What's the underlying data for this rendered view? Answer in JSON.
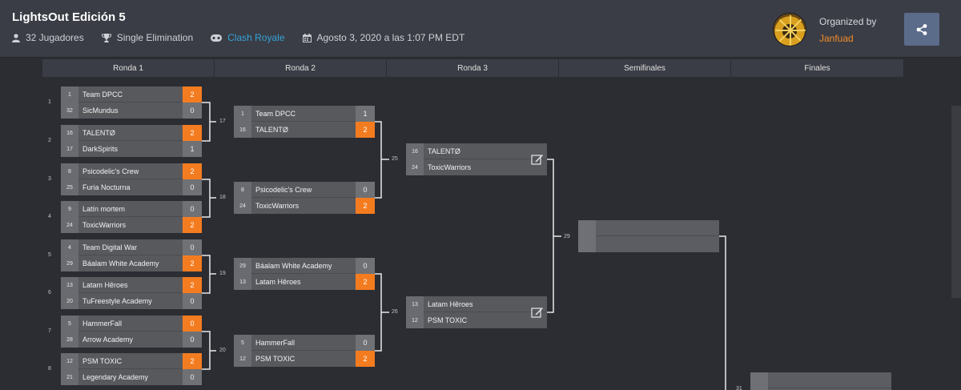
{
  "header": {
    "title": "LightsOut Edición 5",
    "players": "32 Jugadores",
    "format": "Single Elimination",
    "game": "Clash Royale",
    "date": "Agosto 3, 2020 a las 1:07 PM EDT",
    "organized_by_label": "Organized by",
    "organizer": "Janfuad"
  },
  "rounds": [
    "Ronda 1",
    "Ronda 2",
    "Ronda 3",
    "Semifinales",
    "Finales"
  ],
  "round1": [
    {
      "num": "17",
      "p1": {
        "seed": "1",
        "name": "Team DPCC",
        "score": "2",
        "win": true
      },
      "p2": {
        "seed": "32",
        "name": "SicMundus",
        "score": "0",
        "win": false
      }
    },
    {
      "num": "17",
      "p1": {
        "seed": "16",
        "name": "TALENTØ",
        "score": "2",
        "win": true
      },
      "p2": {
        "seed": "17",
        "name": "DarkSpirits",
        "score": "1",
        "win": false
      }
    },
    {
      "num": "18",
      "p1": {
        "seed": "8",
        "name": "Psicodelic's Crew",
        "score": "2",
        "win": true
      },
      "p2": {
        "seed": "25",
        "name": "Furia Nocturna",
        "score": "0",
        "win": false
      }
    },
    {
      "num": "18",
      "p1": {
        "seed": "9",
        "name": "Latín mortem",
        "score": "0",
        "win": false
      },
      "p2": {
        "seed": "24",
        "name": "ToxicWarriors",
        "score": "2",
        "win": true
      }
    },
    {
      "num": "19",
      "p1": {
        "seed": "4",
        "name": "Team Digital War",
        "score": "0",
        "win": false
      },
      "p2": {
        "seed": "29",
        "name": "Báalam White Academy",
        "score": "2",
        "win": true
      }
    },
    {
      "num": "19",
      "p1": {
        "seed": "13",
        "name": "Latam Hêroes",
        "score": "2",
        "win": true
      },
      "p2": {
        "seed": "20",
        "name": "TuFreestyle Academy",
        "score": "0",
        "win": false
      }
    },
    {
      "num": "20",
      "p1": {
        "seed": "5",
        "name": "HammerFall",
        "score": "0",
        "win": true
      },
      "p2": {
        "seed": "28",
        "name": "Arrow Academy",
        "score": "0",
        "win": false
      }
    },
    {
      "num": "20",
      "p1": {
        "seed": "12",
        "name": "PSM TOXIC",
        "score": "2",
        "win": true
      },
      "p2": {
        "seed": "21",
        "name": "Legendary Academy",
        "score": "0",
        "win": false
      }
    }
  ],
  "round1_labels": [
    "1",
    "2",
    "3",
    "4",
    "5",
    "6",
    "7",
    "8"
  ],
  "round2": [
    {
      "p1": {
        "seed": "1",
        "name": "Team DPCC",
        "score": "1",
        "win": false
      },
      "p2": {
        "seed": "16",
        "name": "TALENTØ",
        "score": "2",
        "win": true
      }
    },
    {
      "p1": {
        "seed": "8",
        "name": "Psicodelic's Crew",
        "score": "0",
        "win": false
      },
      "p2": {
        "seed": "24",
        "name": "ToxicWarriors",
        "score": "2",
        "win": true
      }
    },
    {
      "p1": {
        "seed": "29",
        "name": "Báalam White Academy",
        "score": "0",
        "win": false
      },
      "p2": {
        "seed": "13",
        "name": "Latam Hêroes",
        "score": "2",
        "win": true
      }
    },
    {
      "p1": {
        "seed": "5",
        "name": "HammerFall",
        "score": "0",
        "win": false
      },
      "p2": {
        "seed": "12",
        "name": "PSM TOXIC",
        "score": "2",
        "win": true
      }
    }
  ],
  "round2_labels": [
    "17",
    "18",
    "19",
    "20"
  ],
  "round3": [
    {
      "p1": {
        "seed": "16",
        "name": "TALENTØ"
      },
      "p2": {
        "seed": "24",
        "name": "ToxicWarriors"
      }
    },
    {
      "p1": {
        "seed": "13",
        "name": "Latam Hêroes"
      },
      "p2": {
        "seed": "12",
        "name": "PSM TOXIC"
      }
    }
  ],
  "round3_labels": [
    "25",
    "26"
  ],
  "semifinal_label": "29",
  "final_label": "31"
}
